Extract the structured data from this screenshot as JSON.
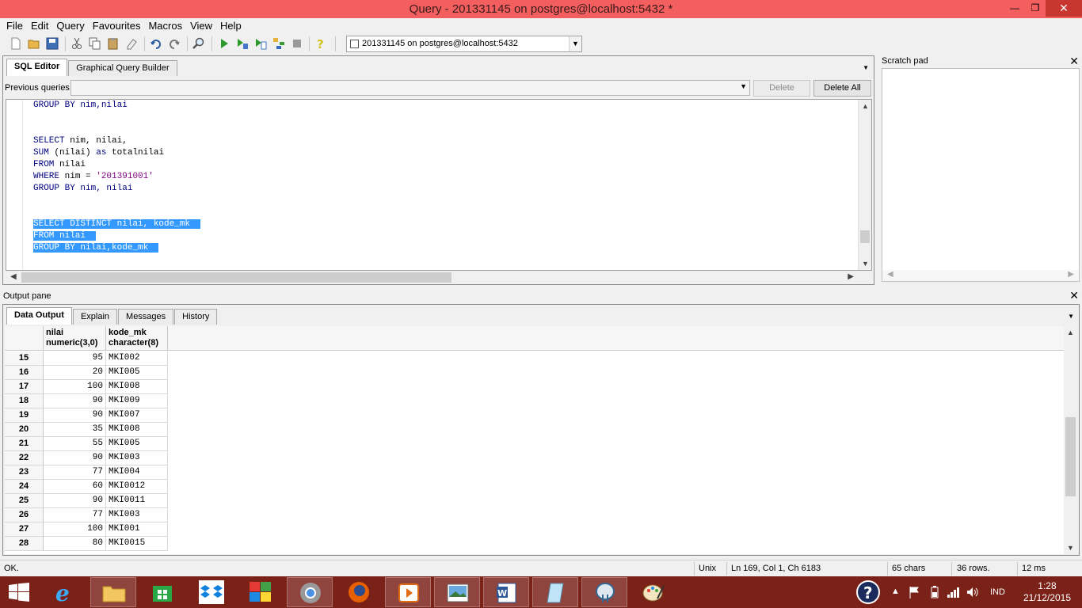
{
  "window": {
    "title": "Query - 201331145 on postgres@localhost:5432 *",
    "minimize": "—",
    "maximize": "❐",
    "close": "✕"
  },
  "menu": [
    "File",
    "Edit",
    "Query",
    "Favourites",
    "Macros",
    "View",
    "Help"
  ],
  "toolbar": {
    "connection": "201331145 on postgres@localhost:5432"
  },
  "editor": {
    "tabs": [
      "SQL Editor",
      "Graphical Query Builder"
    ],
    "previous_queries_label": "Previous queries",
    "delete_label": "Delete",
    "delete_all_label": "Delete All"
  },
  "sql": {
    "l01": "GROUP BY nim,nilai",
    "l04a": "SELECT",
    "l04b": " nim, nilai,",
    "l05a": "SUM",
    "l05b": " (nilai) ",
    "l05c": "as",
    "l05d": " totalnilai",
    "l06a": "FROM",
    "l06b": " nilai",
    "l07a": "WHERE",
    "l07b": " nim = ",
    "l07c": "'201391001'",
    "l08": "GROUP BY nim, nilai",
    "l11": "SELECT DISTINCT nilai, kode_mk ",
    "l12": "FROM nilai ",
    "l13": "GROUP BY nilai,kode_mk "
  },
  "scratch_pad": {
    "title": "Scratch pad"
  },
  "output": {
    "title": "Output pane",
    "tabs": [
      "Data Output",
      "Explain",
      "Messages",
      "History"
    ],
    "columns": [
      {
        "name": "nilai",
        "type": "numeric(3,0)"
      },
      {
        "name": "kode_mk",
        "type": "character(8)"
      }
    ],
    "rows": [
      {
        "n": "15",
        "nilai": "95",
        "kode": "MKI002"
      },
      {
        "n": "16",
        "nilai": "20",
        "kode": "MKI005"
      },
      {
        "n": "17",
        "nilai": "100",
        "kode": "MKI008"
      },
      {
        "n": "18",
        "nilai": "90",
        "kode": "MKI009"
      },
      {
        "n": "19",
        "nilai": "90",
        "kode": "MKI007"
      },
      {
        "n": "20",
        "nilai": "35",
        "kode": "MKI008"
      },
      {
        "n": "21",
        "nilai": "55",
        "kode": "MKI005"
      },
      {
        "n": "22",
        "nilai": "90",
        "kode": "MKI003"
      },
      {
        "n": "23",
        "nilai": "77",
        "kode": "MKI004"
      },
      {
        "n": "24",
        "nilai": "60",
        "kode": "MKI0012"
      },
      {
        "n": "25",
        "nilai": "90",
        "kode": "MKI0011"
      },
      {
        "n": "26",
        "nilai": "77",
        "kode": "MKI003"
      },
      {
        "n": "27",
        "nilai": "100",
        "kode": "MKI001"
      },
      {
        "n": "28",
        "nilai": "80",
        "kode": "MKI0015"
      }
    ]
  },
  "status": {
    "message": "OK.",
    "line_ending": "Unix",
    "position": "Ln 169, Col 1, Ch 6183",
    "chars": "65 chars",
    "rows": "36 rows.",
    "time": "12 ms"
  },
  "taskbar": {
    "language": "IND",
    "time": "1:28",
    "date": "21/12/2015"
  }
}
